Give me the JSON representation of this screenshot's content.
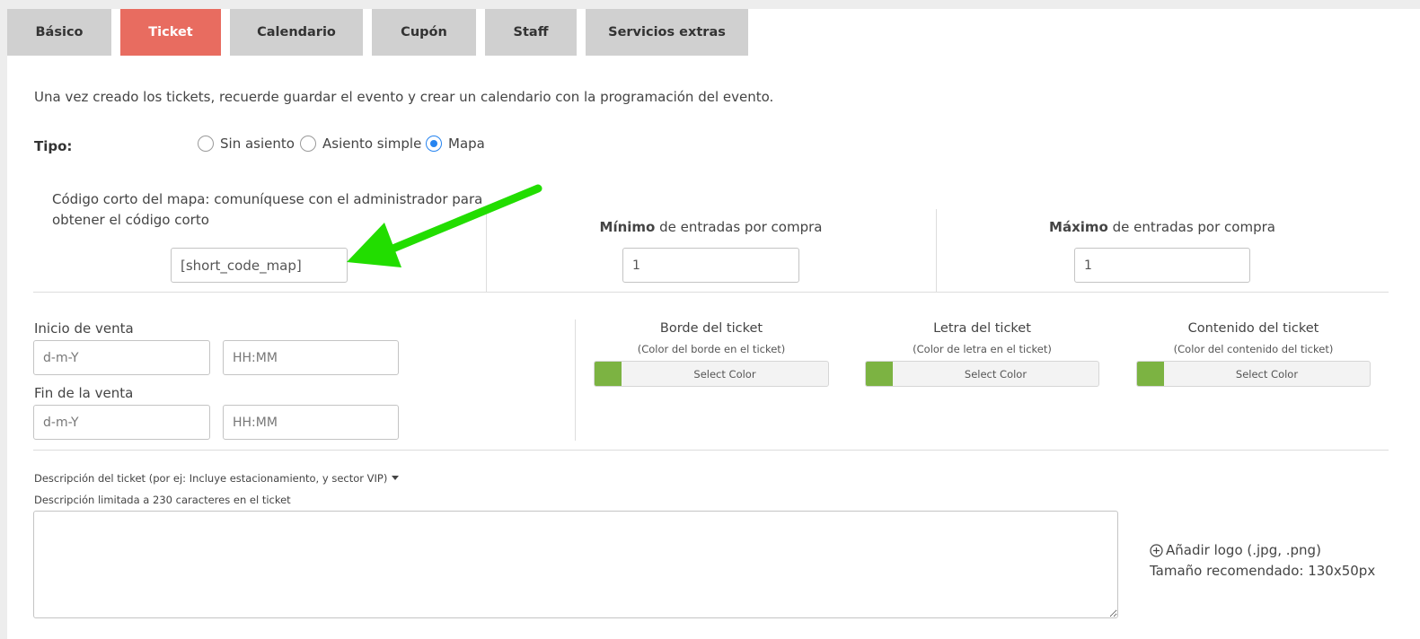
{
  "tabs": [
    {
      "label": "Básico"
    },
    {
      "label": "Ticket"
    },
    {
      "label": "Calendario"
    },
    {
      "label": "Cupón"
    },
    {
      "label": "Staff"
    },
    {
      "label": "Servicios extras"
    }
  ],
  "active_tab": "Ticket",
  "intro_text": "Una vez creado los tickets, recuerde guardar el evento y crear un calendario con la programación del evento.",
  "tipo": {
    "label": "Tipo:",
    "options": [
      {
        "label": "Sin asiento",
        "checked": false
      },
      {
        "label": "Asiento simple",
        "checked": false
      },
      {
        "label": "Mapa",
        "checked": true
      }
    ]
  },
  "map_code": {
    "label_line1": "Código corto del mapa: comuníquese con el administrador para",
    "label_line2": "obtener el código corto",
    "value": "[short_code_map]"
  },
  "min_entries": {
    "bold": "Mínimo",
    "rest": " de entradas por compra",
    "value": "1"
  },
  "max_entries": {
    "bold": "Máximo",
    "rest": " de entradas por compra",
    "value": "1"
  },
  "sale_start": {
    "label": "Inicio de venta",
    "date_placeholder": "d-m-Y",
    "time_placeholder": "HH:MM"
  },
  "sale_end": {
    "label": "Fin de la venta",
    "date_placeholder": "d-m-Y",
    "time_placeholder": "HH:MM"
  },
  "colors": [
    {
      "title": "Borde del ticket",
      "subtitle": "(Color del borde en el ticket)",
      "button": "Select Color",
      "swatch": "#7cb342"
    },
    {
      "title": "Letra del ticket",
      "subtitle": "(Color de letra en el ticket)",
      "button": "Select Color",
      "swatch": "#7cb342"
    },
    {
      "title": "Contenido del ticket",
      "subtitle": "(Color del contenido del ticket)",
      "button": "Select Color",
      "swatch": "#7cb342"
    }
  ],
  "description": {
    "label": "Descripción del ticket (por ej: Incluye estacionamiento, y sector VIP)",
    "limit_note": "Descripción limitada a 230 caracteres en el ticket"
  },
  "logo": {
    "add_label": "Añadir logo (.jpg, .png)",
    "size_note": "Tamaño recomendado: 130x50px"
  },
  "accent_colors": {
    "active_tab": "#e86c60",
    "radio": "#2684f0",
    "arrow": "#22dd00"
  }
}
